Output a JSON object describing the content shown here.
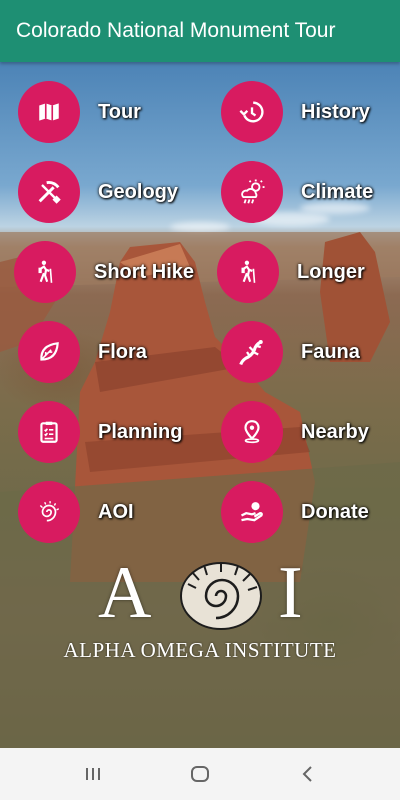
{
  "app": {
    "title": "Colorado National Monument Tour",
    "accent": "#1e8f73",
    "button_color": "#d81b60"
  },
  "menu": [
    {
      "label": "Tour",
      "icon": "map-icon"
    },
    {
      "label": "History",
      "icon": "history-icon"
    },
    {
      "label": "Geology",
      "icon": "pick-shovel-icon"
    },
    {
      "label": "Climate",
      "icon": "weather-icon"
    },
    {
      "label": "Short Hike",
      "icon": "hiker-icon"
    },
    {
      "label": "Longer",
      "icon": "hiker-icon"
    },
    {
      "label": "Flora",
      "icon": "leaf-icon"
    },
    {
      "label": "Fauna",
      "icon": "lizard-icon"
    },
    {
      "label": "Planning",
      "icon": "clipboard-icon"
    },
    {
      "label": "Nearby",
      "icon": "location-pin-icon"
    },
    {
      "label": "AOI",
      "icon": "ammonite-icon"
    },
    {
      "label": "Donate",
      "icon": "donate-hand-icon"
    }
  ],
  "logo": {
    "letter_a": "A",
    "letter_i": "I",
    "text": "ALPHA OMEGA INSTITUTE"
  },
  "navbar": {
    "recent": "recent-apps-icon",
    "home": "home-icon",
    "back": "back-icon"
  }
}
